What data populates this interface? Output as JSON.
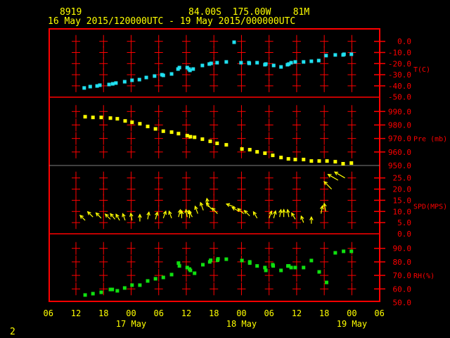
{
  "header": {
    "station_id": "8919",
    "location": "84.00S  175.00W    81M",
    "period": "16 May 2015/120000UTC - 19 May 2015/000000UTC"
  },
  "page_number": "2",
  "colors": {
    "frame": "#ff0000",
    "text": "#ffff00",
    "temp": "#20e0f0",
    "pressure": "#ffff00",
    "wind": "#ffff00",
    "rh": "#10e010",
    "separator": "#808080"
  },
  "chart_data": {
    "type": "scatter",
    "title": "8919  84.00S 175.00W 81M",
    "subtitle": "16 May 2015/120000UTC - 19 May 2015/000000UTC",
    "x_unit": "hours since 16 May 2015 12UTC",
    "xlim": [
      -6,
      66
    ],
    "x_ticks": [
      "06",
      "12",
      "18",
      "00",
      "06",
      "12",
      "18",
      "00",
      "06",
      "12",
      "18",
      "00",
      "06"
    ],
    "x_day_labels": [
      {
        "label": "17 May",
        "at": 12
      },
      {
        "label": "18 May",
        "at": 36
      },
      {
        "label": "19 May",
        "at": 60
      }
    ],
    "grid": true,
    "panels": [
      {
        "id": "temp",
        "label": "T(C)",
        "ylim": [
          -50,
          0
        ],
        "ticks": [
          "0.0",
          "-10.0",
          "-20.0",
          "-30.0",
          "-40.0",
          "-50.0"
        ],
        "tick_values": [
          0,
          -10,
          -20,
          -30,
          -40,
          -50
        ],
        "points": [
          [
            1.8,
            -41.9
          ],
          [
            3.1,
            -40.7
          ],
          [
            4.6,
            -40.1
          ],
          [
            5.2,
            -39.4
          ],
          [
            7.2,
            -38.8
          ],
          [
            8.0,
            -38.2
          ],
          [
            8.7,
            -37.5
          ],
          [
            10.6,
            -36.3
          ],
          [
            12.2,
            -35.0
          ],
          [
            13.8,
            -34.4
          ],
          [
            15.3,
            -32.5
          ],
          [
            17.1,
            -31.2
          ],
          [
            18.7,
            -30.0
          ],
          [
            19.0,
            -30.6
          ],
          [
            20.8,
            -29.3
          ],
          [
            22.2,
            -24.9
          ],
          [
            22.5,
            -23.6
          ],
          [
            24.2,
            -23.6
          ],
          [
            24.6,
            -24.9
          ],
          [
            24.8,
            -26.1
          ],
          [
            25.5,
            -24.9
          ],
          [
            27.5,
            -21.7
          ],
          [
            29.0,
            -20.4
          ],
          [
            29.4,
            -19.8
          ],
          [
            30.7,
            -19.2
          ],
          [
            32.7,
            -18.5
          ],
          [
            34.4,
            -0.8
          ],
          [
            35.9,
            -19.2
          ],
          [
            37.6,
            -19.2
          ],
          [
            37.7,
            -19.8
          ],
          [
            39.4,
            -19.2
          ],
          [
            41.1,
            -21.0
          ],
          [
            41.3,
            -20.4
          ],
          [
            43.0,
            -21.7
          ],
          [
            44.6,
            -23.0
          ],
          [
            46.0,
            -21.0
          ],
          [
            46.3,
            -20.4
          ],
          [
            46.8,
            -19.2
          ],
          [
            47.7,
            -18.5
          ],
          [
            49.5,
            -18.5
          ],
          [
            51.2,
            -17.9
          ],
          [
            52.8,
            -17.3
          ],
          [
            54.4,
            -12.8
          ],
          [
            56.4,
            -12.2
          ],
          [
            58.1,
            -12.2
          ],
          [
            58.3,
            -11.6
          ],
          [
            59.9,
            -11.6
          ]
        ]
      },
      {
        "id": "pressure",
        "label": "Pre (mb)",
        "ylim": [
          950,
          990
        ],
        "ticks": [
          "990.0",
          "980.0",
          "970.0",
          "960.0",
          "950.0"
        ],
        "tick_values": [
          990,
          980,
          970,
          960,
          950
        ],
        "points": [
          [
            2.0,
            986.1
          ],
          [
            3.7,
            985.6
          ],
          [
            5.5,
            985.6
          ],
          [
            7.5,
            985.1
          ],
          [
            9.0,
            984.6
          ],
          [
            10.7,
            983.0
          ],
          [
            12.2,
            982.0
          ],
          [
            13.9,
            980.9
          ],
          [
            15.6,
            978.9
          ],
          [
            17.3,
            977.1
          ],
          [
            19.0,
            975.4
          ],
          [
            20.8,
            974.7
          ],
          [
            22.3,
            973.6
          ],
          [
            24.2,
            972.1
          ],
          [
            24.9,
            971.3
          ],
          [
            25.8,
            970.9
          ],
          [
            27.5,
            969.5
          ],
          [
            29.2,
            967.9
          ],
          [
            30.7,
            966.4
          ],
          [
            32.7,
            965.3
          ],
          [
            36.1,
            962.2
          ],
          [
            37.8,
            961.7
          ],
          [
            39.4,
            960.1
          ],
          [
            41.1,
            959.1
          ],
          [
            42.8,
            957.5
          ],
          [
            44.6,
            955.9
          ],
          [
            46.2,
            954.9
          ],
          [
            47.7,
            954.4
          ],
          [
            49.5,
            954.4
          ],
          [
            51.2,
            953.3
          ],
          [
            52.9,
            953.3
          ],
          [
            54.6,
            953.3
          ],
          [
            56.4,
            952.8
          ],
          [
            58.1,
            951.3
          ],
          [
            59.9,
            951.8
          ]
        ]
      },
      {
        "id": "wind",
        "label": "SPD(MPS)",
        "ylim": [
          0,
          25
        ],
        "ticks": [
          "25.0",
          "20.0",
          "15.0",
          "10.0",
          "5.0",
          "0.0"
        ],
        "tick_values": [
          25,
          20,
          15,
          10,
          5,
          0
        ],
        "points": [
          [
            2,
            6,
            315
          ],
          [
            3.7,
            7.5,
            315
          ],
          [
            5.5,
            7,
            315
          ],
          [
            7.5,
            6.5,
            315
          ],
          [
            8.5,
            6.5,
            320
          ],
          [
            9.5,
            6,
            330
          ],
          [
            10.7,
            6,
            340
          ],
          [
            12.2,
            6,
            350
          ],
          [
            13.9,
            5.5,
            0
          ],
          [
            15.6,
            6.5,
            10
          ],
          [
            17.3,
            6.5,
            15
          ],
          [
            19,
            7,
            20
          ],
          [
            20.8,
            7,
            340
          ],
          [
            22.3,
            7.5,
            15
          ],
          [
            23,
            7,
            0
          ],
          [
            24.2,
            7.5,
            350
          ],
          [
            24.7,
            7,
            0
          ],
          [
            25.3,
            7.5,
            330
          ],
          [
            26.5,
            9,
            340
          ],
          [
            27.7,
            10.5,
            340
          ],
          [
            28.8,
            12,
            350
          ],
          [
            29.5,
            11,
            320
          ],
          [
            30.8,
            9,
            315
          ],
          [
            34.5,
            12,
            290
          ],
          [
            35.5,
            10,
            300
          ],
          [
            36.5,
            9,
            310
          ],
          [
            37.8,
            8,
            315
          ],
          [
            39.4,
            7,
            330
          ],
          [
            42,
            7,
            20
          ],
          [
            43,
            7,
            15
          ],
          [
            44.3,
            7.5,
            10
          ],
          [
            45.2,
            7.5,
            0
          ],
          [
            46.3,
            7.5,
            350
          ],
          [
            47.7,
            6.5,
            330
          ],
          [
            49.5,
            5,
            340
          ],
          [
            51.2,
            4.5,
            0
          ],
          [
            53.3,
            9,
            10
          ],
          [
            54.3,
            10,
            350
          ],
          [
            55.6,
            20,
            315
          ],
          [
            57,
            24,
            300
          ],
          [
            58.5,
            25,
            300
          ]
        ]
      },
      {
        "id": "rh",
        "label": "RH(%)",
        "ylim": [
          50,
          90
        ],
        "ticks": [
          "90.0",
          "80.0",
          "70.0",
          "60.0",
          "50.0"
        ],
        "tick_values": [
          90,
          80,
          70,
          60,
          50
        ],
        "points": [
          [
            2.0,
            55.5
          ],
          [
            3.7,
            56.5
          ],
          [
            5.5,
            57.5
          ],
          [
            7.5,
            59.6
          ],
          [
            7.9,
            59.6
          ],
          [
            9.0,
            58.6
          ],
          [
            10.6,
            60.7
          ],
          [
            12.2,
            62.8
          ],
          [
            13.9,
            62.8
          ],
          [
            15.6,
            65.9
          ],
          [
            17.3,
            67.5
          ],
          [
            19.0,
            68.5
          ],
          [
            20.8,
            70.6
          ],
          [
            22.3,
            79.1
          ],
          [
            22.5,
            77.0
          ],
          [
            24.2,
            75.8
          ],
          [
            24.7,
            74.7
          ],
          [
            24.9,
            73.7
          ],
          [
            25.8,
            71.6
          ],
          [
            27.6,
            77.9
          ],
          [
            29.1,
            80.0
          ],
          [
            29.3,
            81.2
          ],
          [
            30.8,
            81.2
          ],
          [
            30.9,
            82.2
          ],
          [
            32.7,
            82.0
          ],
          [
            36.1,
            81.0
          ],
          [
            37.8,
            80.0
          ],
          [
            37.8,
            79.1
          ],
          [
            39.4,
            77.0
          ],
          [
            41.1,
            75.8
          ],
          [
            41.3,
            73.7
          ],
          [
            42.8,
            77.9
          ],
          [
            42.9,
            77.0
          ],
          [
            44.6,
            73.7
          ],
          [
            46.1,
            77.0
          ],
          [
            46.3,
            77.0
          ],
          [
            46.8,
            75.8
          ],
          [
            47.7,
            75.8
          ],
          [
            49.5,
            75.8
          ],
          [
            51.2,
            81.0
          ],
          [
            52.9,
            72.6
          ],
          [
            54.5,
            64.8
          ],
          [
            56.4,
            86.7
          ],
          [
            58.2,
            87.8
          ],
          [
            59.9,
            87.8
          ]
        ]
      }
    ]
  }
}
